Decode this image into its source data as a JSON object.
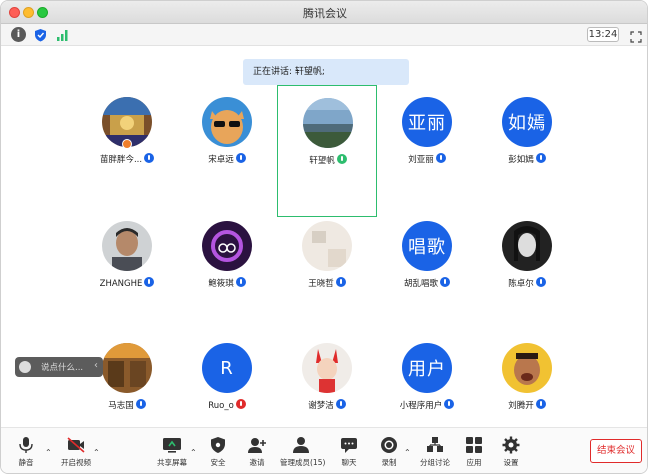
{
  "window": {
    "title": "腾讯会议"
  },
  "toolbar": {
    "time": "13:24"
  },
  "speaking": {
    "label": "正在讲话: 轩望帆;"
  },
  "participants": [
    {
      "name": "苗胖胖今...",
      "avatar_type": "photo",
      "mic": "blue"
    },
    {
      "name": "宋卓远",
      "avatar_type": "photo",
      "mic": "blue"
    },
    {
      "name": "轩望帆",
      "avatar_type": "photo",
      "mic": "green"
    },
    {
      "name": "刘亚丽",
      "avatar_text": "亚丽",
      "mic": "blue"
    },
    {
      "name": "彭如嫣",
      "avatar_text": "如嫣",
      "mic": "blue"
    },
    {
      "name": "ZHANGHE",
      "avatar_type": "photo",
      "mic": "blue"
    },
    {
      "name": "鲍筱琪",
      "avatar_type": "photo",
      "mic": "blue"
    },
    {
      "name": "王晓哲",
      "avatar_type": "photo",
      "mic": "blue"
    },
    {
      "name": "胡乱唱歌",
      "avatar_text": "唱歌",
      "mic": "blue"
    },
    {
      "name": "陈卓尔",
      "avatar_type": "photo",
      "mic": "blue"
    },
    {
      "name": "马志国",
      "avatar_type": "photo",
      "mic": "blue"
    },
    {
      "name": "Ruo_o",
      "avatar_text": "R",
      "mic": "red"
    },
    {
      "name": "谢梦洁",
      "avatar_type": "photo",
      "mic": "blue"
    },
    {
      "name": "小程序用户",
      "avatar_text": "用户",
      "mic": "blue"
    },
    {
      "name": "刘腾开",
      "avatar_type": "photo",
      "mic": "blue"
    }
  ],
  "chat": {
    "placeholder": "说点什么..."
  },
  "bottom": {
    "mute": "静音",
    "video": "开启视频",
    "share": "共享屏幕",
    "security": "安全",
    "invite": "邀请",
    "members": "管理成员(15)",
    "chat": "聊天",
    "record": "录制",
    "breakout": "分组讨论",
    "apps": "应用",
    "settings": "设置",
    "end": "结束会议"
  },
  "colors": {
    "accent": "#1a63e6",
    "end": "#e02b2b",
    "speaking": "#2dbd6e"
  }
}
